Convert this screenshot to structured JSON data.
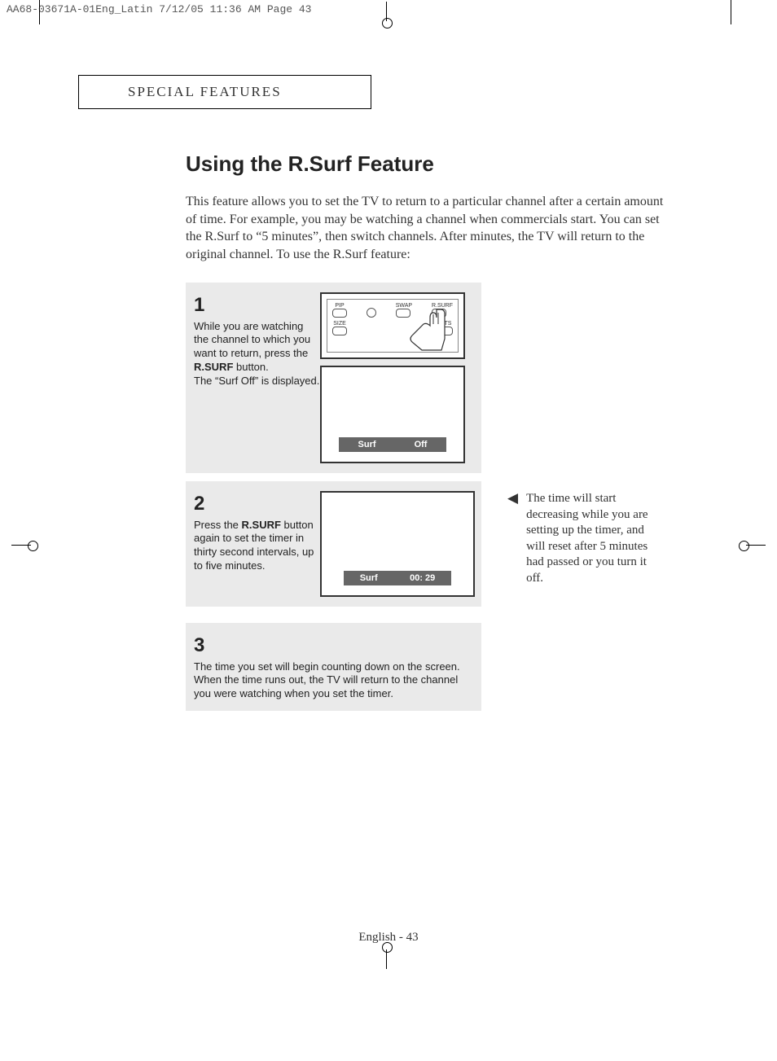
{
  "print_header": "AA68-03671A-01Eng_Latin  7/12/05  11:36 AM  Page 43",
  "section_header": "SPECIAL FEATURES",
  "title": "Using the R.Surf Feature",
  "intro": "This feature allows you to set the TV to return to a particular channel after a certain amount of time. For example, you may be watching a channel when commercials start. You can set the R.Surf to “5 minutes”, then switch channels. After minutes, the TV will return to the original channel. To use the R.Surf feature:",
  "steps": {
    "s1": {
      "num": "1",
      "text_a": "While you are watching the channel to which you want to return, press the ",
      "text_bold": "R.SURF",
      "text_b": " button.",
      "text_c": "The “Surf Off” is displayed.",
      "screen_label_left": "Surf",
      "screen_label_right": "Off",
      "remote_labels": {
        "pip": "PIP",
        "swap": "SWAP",
        "rsurf": "R.SURF",
        "size": "SIZE",
        "mts": "MTS"
      }
    },
    "s2": {
      "num": "2",
      "text_a": "Press the ",
      "text_bold": "R.SURF",
      "text_b": " button again to set the timer in thirty second intervals, up to five minutes.",
      "screen_label_left": "Surf",
      "screen_label_right": "00:  29"
    },
    "s3": {
      "num": "3",
      "text": "The time you set will begin counting down on the screen. When the time runs out, the TV will return to the channel you were watching when you set the timer."
    }
  },
  "side_note": "The time will start decreasing while you are setting up the timer, and will reset after 5 minutes had passed or you turn it off.",
  "footer": "English - 43"
}
